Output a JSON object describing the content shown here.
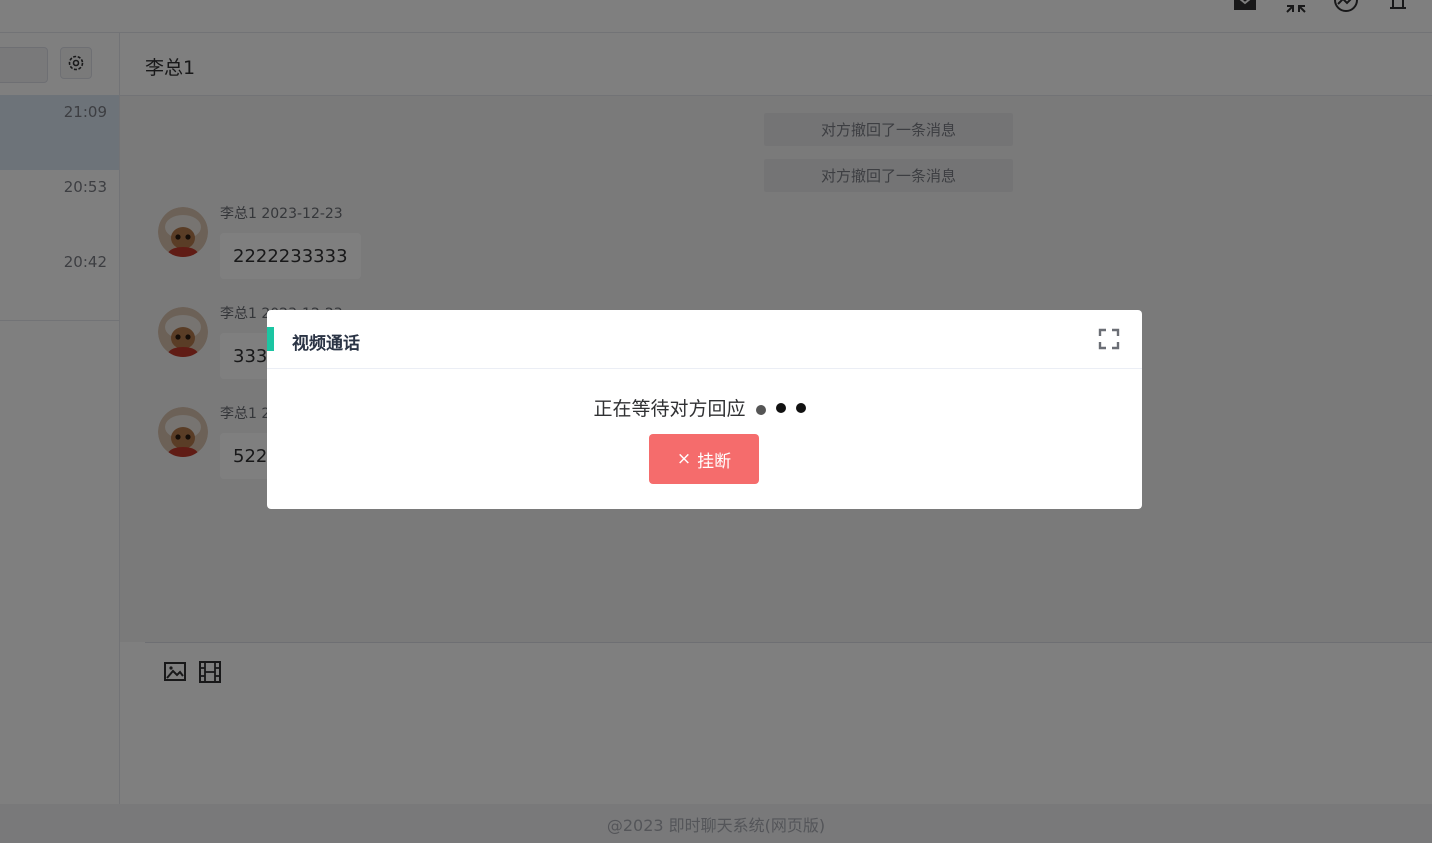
{
  "app": {
    "footer": "@2023 即时聊天系统(网页版)"
  },
  "topbar": {
    "icons": [
      "mail-icon",
      "collapse-icon",
      "chart-icon",
      "bell-icon"
    ]
  },
  "conversations": [
    {
      "time": "21:09",
      "active": true
    },
    {
      "time": "20:53",
      "active": false
    },
    {
      "time": "20:42",
      "active": false
    }
  ],
  "chat": {
    "title": "李总1",
    "system_messages": [
      "对方撤回了一条消息",
      "对方撤回了一条消息"
    ],
    "messages": [
      {
        "meta": "李总1 2023-12-23",
        "text": "2222233333"
      },
      {
        "meta": "李总1 2023-12-23",
        "text": "333"
      },
      {
        "meta": "李总1 2",
        "text": "5225"
      }
    ],
    "tools": [
      "image-icon",
      "video-icon"
    ]
  },
  "dialog": {
    "title": "视频通话",
    "waiting_text": "正在等待对方回应",
    "hangup_icon": "×",
    "hangup_label": "挂断",
    "colors": {
      "accent": "#1bc5a2",
      "hangup": "#f56c6c"
    }
  }
}
